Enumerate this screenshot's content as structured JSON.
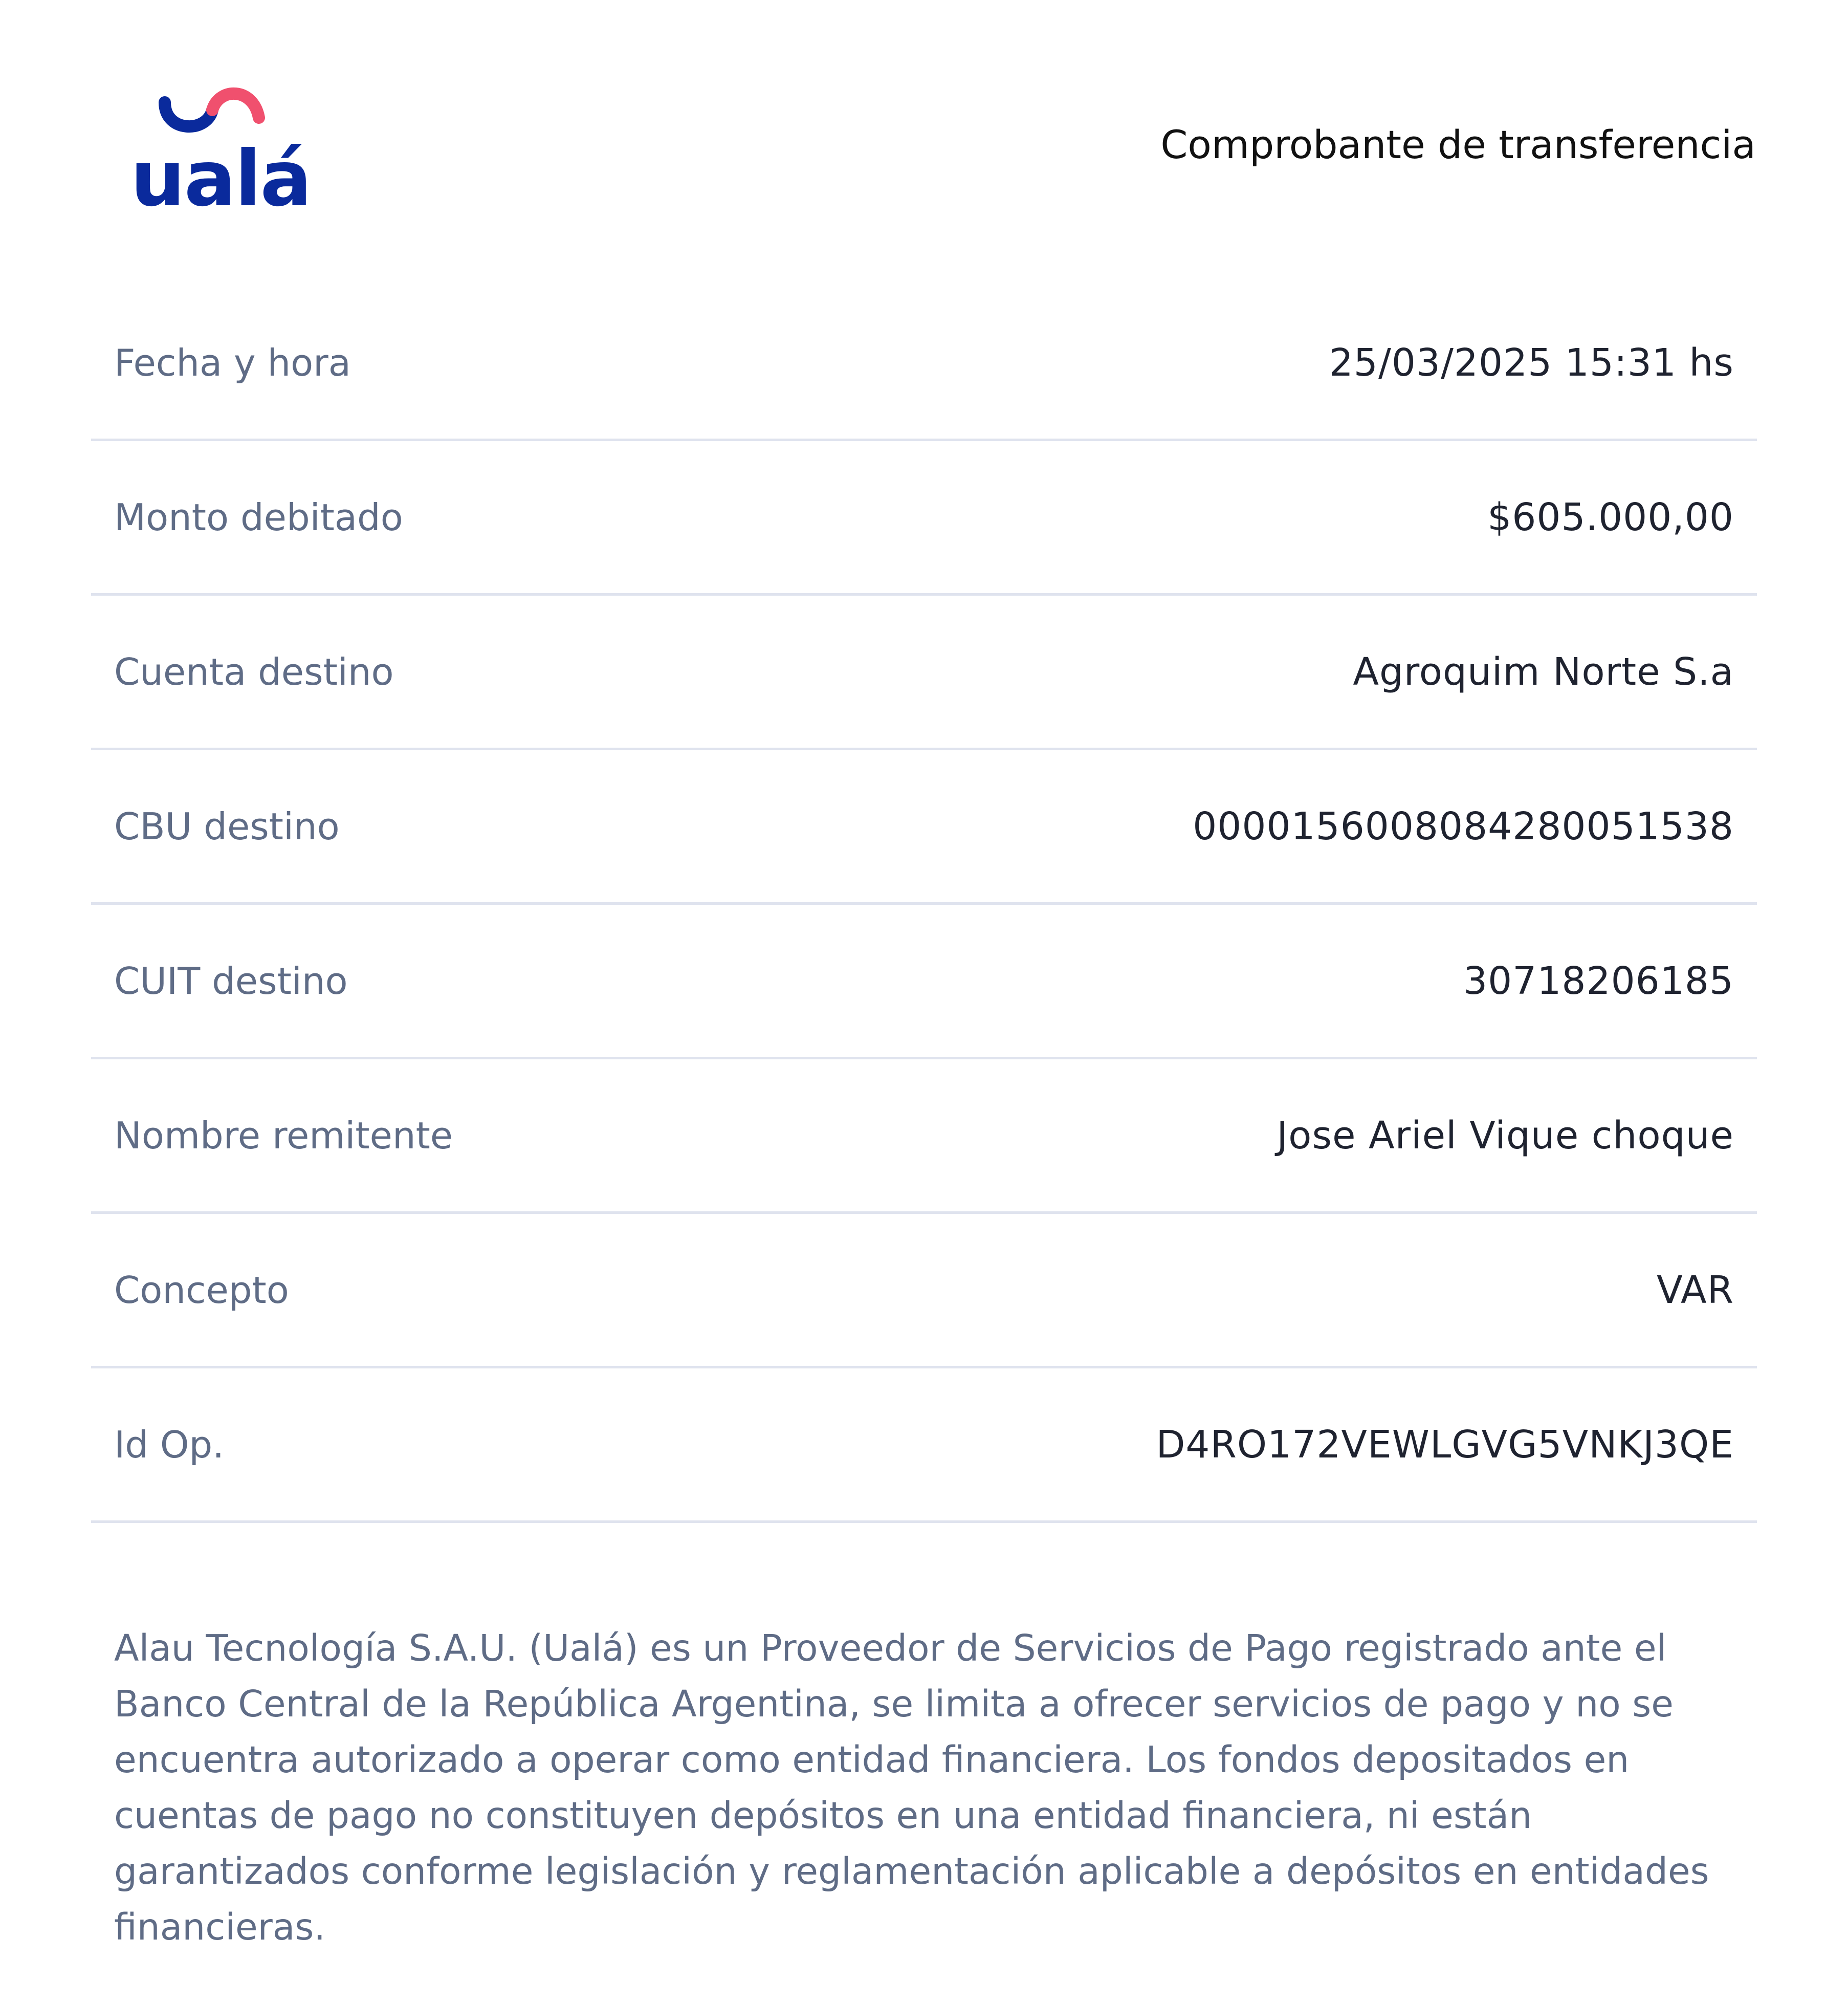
{
  "logo": {
    "wordmark": "ualá",
    "primary_color": "#0a2a9c",
    "accent_color": "#f0506e"
  },
  "header": {
    "title": "Comprobante de transferencia"
  },
  "rows": [
    {
      "label": "Fecha y hora",
      "value": "25/03/2025 15:31 hs"
    },
    {
      "label": "Monto debitado",
      "value": "$605.000,00"
    },
    {
      "label": "Cuenta destino",
      "value": "Agroquim Norte S.a"
    },
    {
      "label": "CBU destino",
      "value": "0000156008084280051538"
    },
    {
      "label": "CUIT destino",
      "value": "30718206185"
    },
    {
      "label": "Nombre remitente",
      "value": "Jose Ariel Vique choque"
    },
    {
      "label": "Concepto",
      "value": "VAR"
    },
    {
      "label": "Id Op.",
      "value": "D4RO172VEWLGVG5VNKJ3QE"
    }
  ],
  "disclaimer": "Alau Tecnología S.A.U. (Ualá) es un Proveedor de Servicios de Pago registrado ante el Banco Central de la República Argentina, se limita a ofrecer servicios de pago y no se encuentra autorizado a operar como entidad financiera. Los fondos depositados en cuentas de pago no constituyen depósitos en una entidad financiera, ni están garantizados conforme legislación y reglamentación aplicable a depósitos en entidades financieras."
}
